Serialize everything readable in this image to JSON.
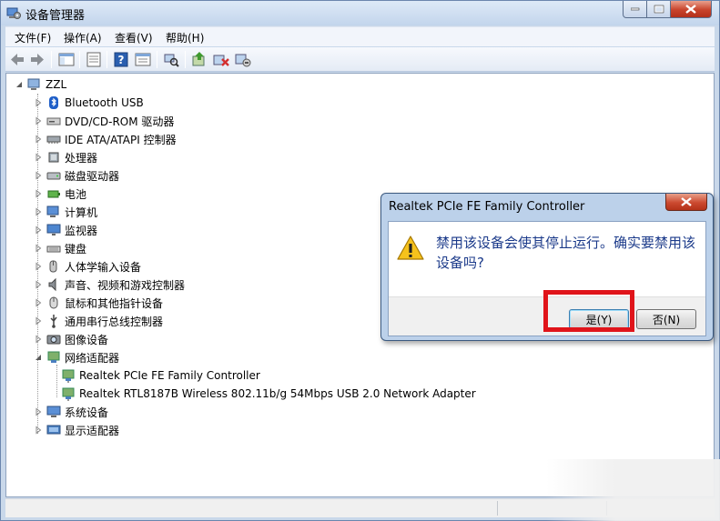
{
  "window": {
    "title": "设备管理器"
  },
  "menu": [
    "文件(F)",
    "操作(A)",
    "查看(V)",
    "帮助(H)"
  ],
  "toolbar": {
    "buttons": [
      "back-icon",
      "forward-icon",
      "show-hide-console-tree-icon",
      "properties-icon",
      "help-icon",
      "console-view-icon",
      "scan-hardware-icon",
      "update-driver-icon",
      "uninstall-icon",
      "disable-icon"
    ]
  },
  "tree": {
    "root": "ZZL",
    "categories": [
      {
        "label": "Bluetooth USB",
        "icon": "bluetooth-icon"
      },
      {
        "label": "DVD/CD-ROM 驱动器",
        "icon": "dvd-drive-icon"
      },
      {
        "label": "IDE ATA/ATAPI 控制器",
        "icon": "ide-controller-icon"
      },
      {
        "label": "处理器",
        "icon": "processor-icon"
      },
      {
        "label": "磁盘驱动器",
        "icon": "disk-drive-icon"
      },
      {
        "label": "电池",
        "icon": "battery-icon"
      },
      {
        "label": "计算机",
        "icon": "computer-icon"
      },
      {
        "label": "监视器",
        "icon": "monitor-icon"
      },
      {
        "label": "键盘",
        "icon": "keyboard-icon"
      },
      {
        "label": "人体学输入设备",
        "icon": "hid-icon"
      },
      {
        "label": "声音、视频和游戏控制器",
        "icon": "sound-icon"
      },
      {
        "label": "鼠标和其他指针设备",
        "icon": "mouse-icon"
      },
      {
        "label": "通用串行总线控制器",
        "icon": "usb-icon"
      },
      {
        "label": "图像设备",
        "icon": "imaging-device-icon"
      },
      {
        "label": "网络适配器",
        "icon": "network-adapter-icon"
      },
      {
        "label": "系统设备",
        "icon": "system-device-icon"
      },
      {
        "label": "显示适配器",
        "icon": "display-adapter-icon"
      }
    ],
    "network_children": [
      "Realtek PCIe FE Family Controller",
      "Realtek RTL8187B Wireless 802.11b/g 54Mbps USB 2.0 Network Adapter"
    ]
  },
  "dialog": {
    "title": "Realtek PCIe FE Family Controller",
    "message": "禁用该设备会使其停止运行。确实要禁用该设备吗?",
    "yes_label": "是(Y)",
    "no_label": "否(N)"
  },
  "colors": {
    "highlight": "#e0141a",
    "window_frame": "#c9d8ea",
    "message_text": "#1b3a8a"
  }
}
